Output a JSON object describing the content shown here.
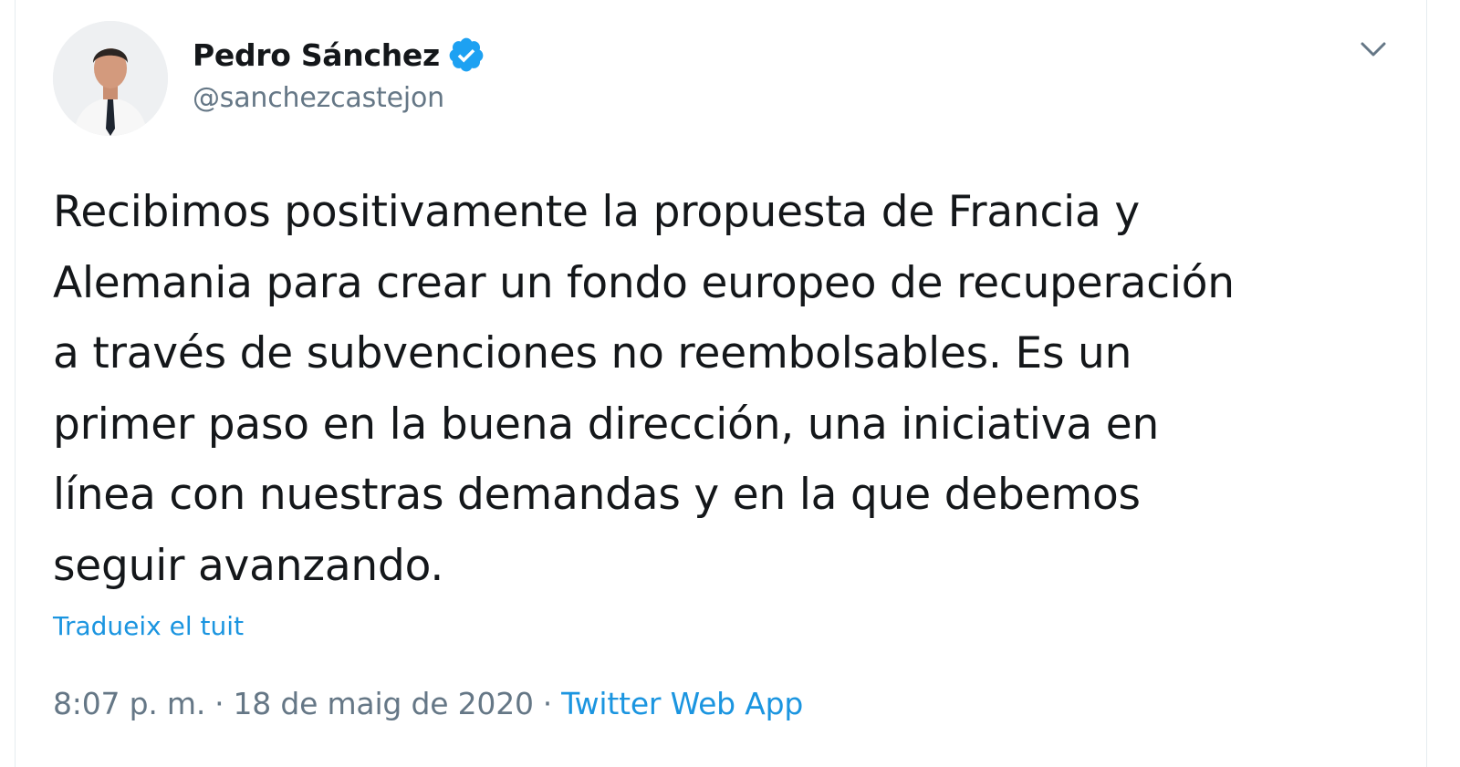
{
  "tweet": {
    "author": {
      "display_name": "Pedro Sánchez",
      "handle": "@sanchezcastejon",
      "verified": true
    },
    "text": "Recibimos positivamente la propuesta de Francia y\nAlemania para crear un fondo europeo de recuperación\na través de subvenciones no reembolsables. Es un\nprimer paso en la buena dirección, una iniciativa en\nlínea con nuestras demandas y en la que debemos\nseguir avanzando.",
    "translate_label": "Tradueix el tuit",
    "time": "8:07 p. m.",
    "date": "18 de maig de 2020",
    "separator": "·",
    "source": "Twitter Web App"
  },
  "icons": {
    "verified": "verified-badge-icon",
    "menu": "chevron-down-icon"
  },
  "colors": {
    "text": "#14171a",
    "secondary": "#657786",
    "link": "#1b95e0",
    "verified": "#1da1f2"
  }
}
